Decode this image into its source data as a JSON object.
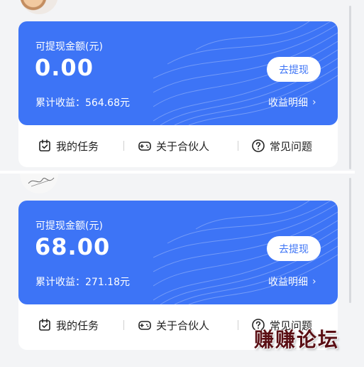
{
  "colors": {
    "accent": "#3d74f6",
    "card_bg": "#ffffff",
    "page_bg": "#f3f4f6",
    "watermark": "#5a0f14"
  },
  "screens": [
    {
      "balance_label": "可提现金额(元)",
      "balance_amount": "0.00",
      "withdraw_label": "去提现",
      "cumulative_label": "累计收益：564.68元",
      "details_label": "收益明细",
      "actions": [
        {
          "label": "我的任务",
          "icon": "task-check-icon"
        },
        {
          "label": "关于合伙人",
          "icon": "gamepad-icon"
        },
        {
          "label": "常见问题",
          "icon": "question-circle-icon"
        }
      ]
    },
    {
      "balance_label": "可提现金额(元)",
      "balance_amount": "68.00",
      "withdraw_label": "去提现",
      "cumulative_label": "累计收益：271.18元",
      "details_label": "收益明细",
      "actions": [
        {
          "label": "我的任务",
          "icon": "task-check-icon"
        },
        {
          "label": "关于合伙人",
          "icon": "gamepad-icon"
        },
        {
          "label": "常见问题",
          "icon": "question-circle-icon"
        }
      ]
    }
  ],
  "watermark": "赚赚论坛"
}
